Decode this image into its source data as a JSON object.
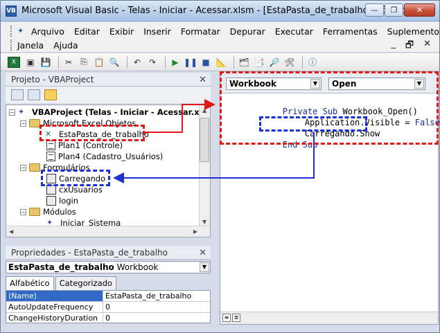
{
  "window": {
    "title": "Microsoft Visual Basic - Telas - Iniciar - Acessar.xlsm - [EstaPasta_de_trabalho (Código)]",
    "minimize_glyph": "▭",
    "restore_glyph": "❐",
    "close_glyph": "✕"
  },
  "menu": {
    "row1": [
      "Arquivo",
      "Editar",
      "Exibir",
      "Inserir",
      "Formatar",
      "Depurar",
      "Executar",
      "Ferramentas",
      "Suplementos"
    ],
    "row2": [
      "Janela",
      "Ajuda"
    ],
    "mdi": [
      "_",
      "🗗",
      "✕"
    ]
  },
  "project_pane": {
    "title": "Projeto - VBAProject",
    "close": "✕",
    "tree": {
      "root": "VBAProject (Telas - Iniciar - Acessar.xlsm)",
      "excel_folder": "Microsoft Excel Objetos",
      "excel_items": [
        "EstaPasta_de_trabalho",
        "Plan1 (Controle)",
        "Plan4 (Cadastro_Usuários)"
      ],
      "forms_folder": "Formulários",
      "forms_items": [
        "Carregando",
        "cxUsuarios",
        "login"
      ],
      "modules_folder": "Módulos",
      "modules_items": [
        "Iniciar_Sistema"
      ]
    }
  },
  "properties_pane": {
    "title": "Propriedades - EstaPasta_de_trabalho",
    "close": "✕",
    "object_name": "EstaPasta_de_trabalho",
    "object_type": "Workbook",
    "tabs": [
      "Alfabético",
      "Categorizado"
    ],
    "rows": [
      {
        "key": "(Name)",
        "value": "EstaPasta_de_trabalho"
      },
      {
        "key": "AutoUpdateFrequency",
        "value": "0"
      },
      {
        "key": "ChangeHistoryDuration",
        "value": "0"
      }
    ]
  },
  "code_window": {
    "object_combo": "Workbook",
    "procedure_combo": "Open",
    "lines": [
      {
        "kw1": "Private Sub",
        "rest": " Workbook_Open()"
      },
      {
        "plain": "Application.Visible = ",
        "kw": "False"
      },
      {
        "plain": "Carregando.Show"
      },
      {
        "kw1": "End Sub"
      }
    ]
  },
  "annotation_colors": {
    "red": "#e31616",
    "blue": "#1f2fd6"
  }
}
